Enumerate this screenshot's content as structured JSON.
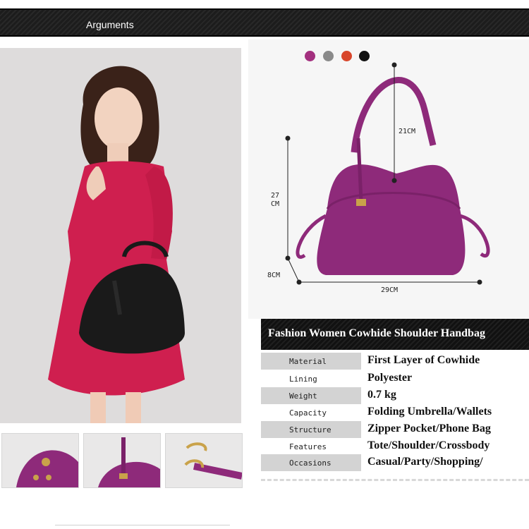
{
  "header": {
    "title": "Arguments"
  },
  "colors": {
    "swatches": [
      "#a3307f",
      "#8a8a8a",
      "#d8462b",
      "#111111"
    ],
    "bag_purple": "#8e2a7a",
    "dress_red": "#cf1f4f",
    "bag_black": "#1a1a1a"
  },
  "dimensions": {
    "height_1": "27",
    "height_2": "CM",
    "strap": "21CM",
    "depth": "8CM",
    "width": "29CM"
  },
  "product": {
    "title": "Fashion Women Cowhide Shoulder Handbag",
    "specs": [
      {
        "label": "Material",
        "value": "First Layer of Cowhide"
      },
      {
        "label": "Lining",
        "value": "Polyester"
      },
      {
        "label": "Weight",
        "value": "0.7 kg"
      },
      {
        "label": "Capacity",
        "value": "Folding Umbrella/Wallets"
      },
      {
        "label": "Structure",
        "value": "Zipper Pocket/Phone Bag"
      },
      {
        "label": "Features",
        "value": "Tote/Shoulder/Crossbody"
      },
      {
        "label": "Occasions",
        "value": "Casual/Party/Shopping/"
      }
    ]
  }
}
